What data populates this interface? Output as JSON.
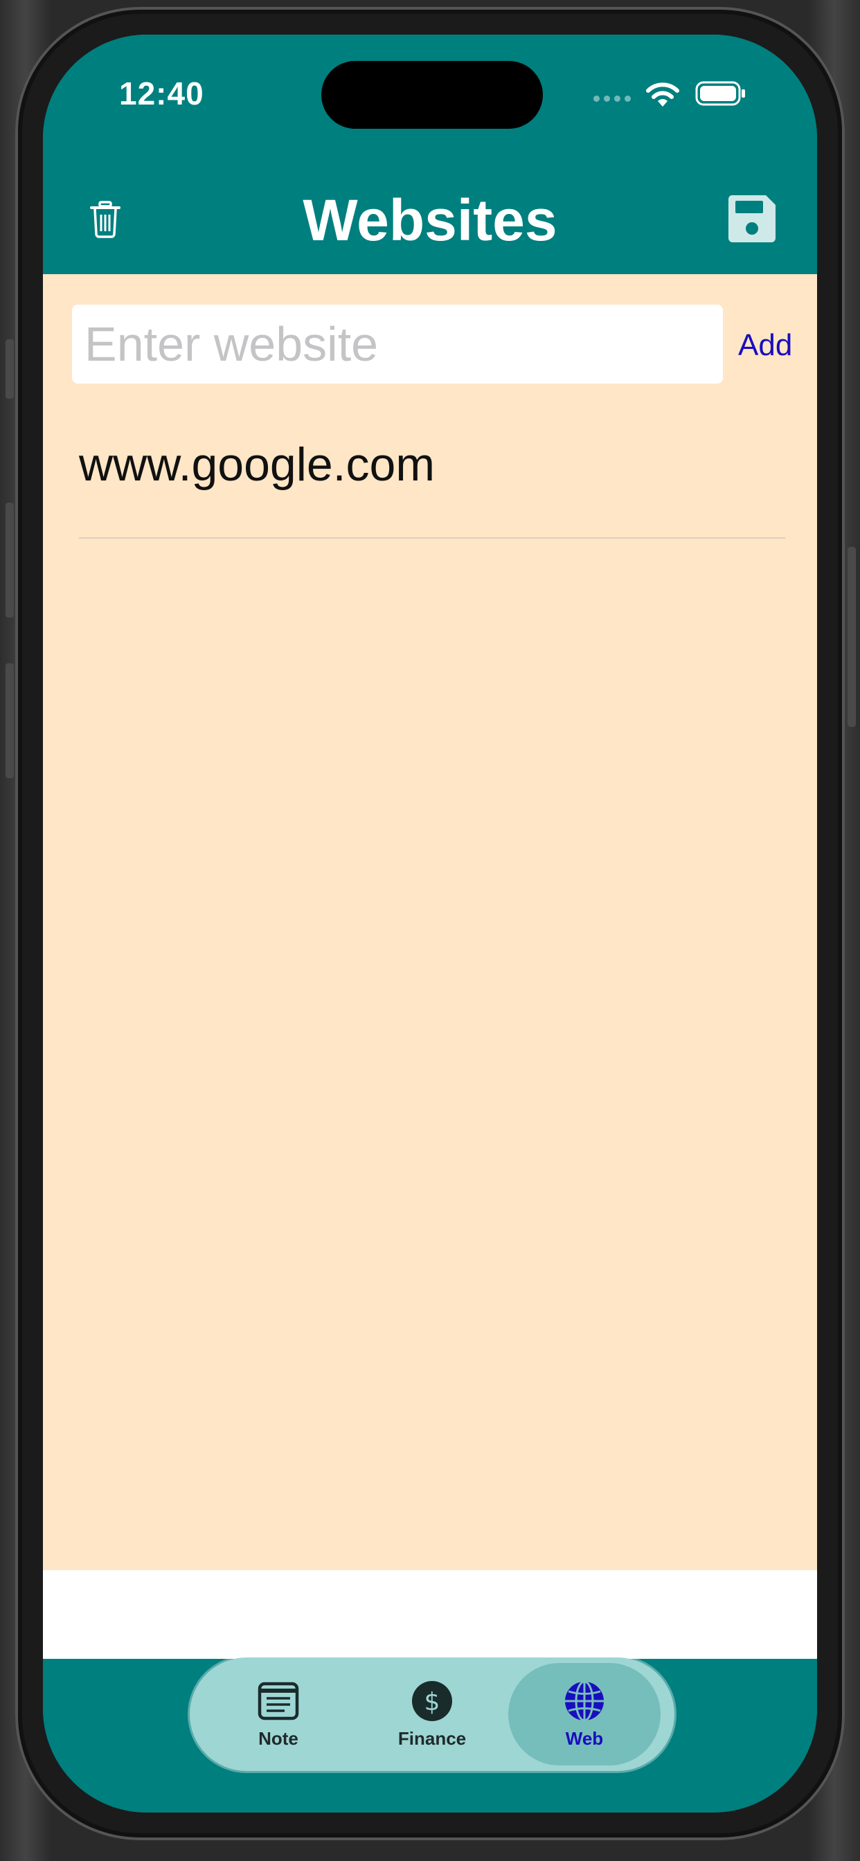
{
  "status": {
    "time": "12:40"
  },
  "header": {
    "title": "Websites"
  },
  "input": {
    "placeholder": "Enter website",
    "value": "",
    "add_label": "Add"
  },
  "sites": [
    {
      "url": "www.google.com"
    }
  ],
  "tabs": [
    {
      "label": "Note",
      "icon": "note-icon",
      "active": false
    },
    {
      "label": "Finance",
      "icon": "dollar-circle-icon",
      "active": false
    },
    {
      "label": "Web",
      "icon": "globe-icon",
      "active": true
    }
  ],
  "colors": {
    "header": "#007f7f",
    "content_bg": "#fee6c6",
    "accent_link": "#1a0dbf",
    "tab_bar": "#9ed6d4",
    "tab_active": "#76bebb"
  }
}
